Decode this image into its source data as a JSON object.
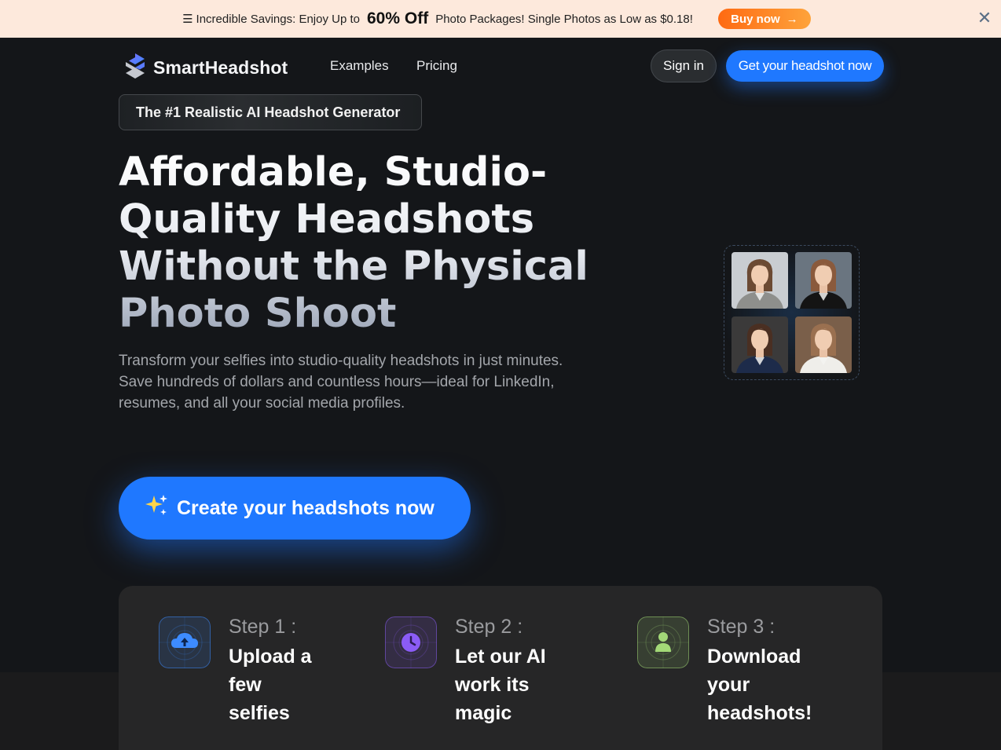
{
  "promo": {
    "menu_glyph": "☰",
    "text_before": "Incredible Savings: Enjoy Up to",
    "highlight": "60% Off",
    "text_after": "Photo Packages! Single Photos as Low as $0.18!",
    "button_label": "Buy now",
    "button_arrow": "→",
    "close_glyph": "✕",
    "colors": {
      "background": "#fde9dc",
      "button_start": "#fe6a12",
      "button_end": "#fea33b"
    }
  },
  "nav": {
    "logo_text": "SmartHeadshot",
    "links": [
      "Examples",
      "Pricing"
    ],
    "signin_label": "Sign in",
    "cta_label": "Get your headshot now",
    "accent": "#1f78ff"
  },
  "hero": {
    "badge": "The #1 Realistic AI Headshot Generator",
    "headline_lines": [
      "Affordable, Studio-",
      "Quality Headshots",
      "Without the Physical",
      "Photo Shoot"
    ],
    "sub_lines": [
      "Transform your selfies into studio-quality headshots in just minutes.",
      "Save hundreds of dollars and countless hours—ideal for LinkedIn,",
      "resumes, and all your social media profiles."
    ],
    "cta_label": "Create your headshots now",
    "cta_icon": "sparkles-icon"
  },
  "photos": [
    {
      "name": "headshot-photo-1",
      "bg": "#c9cdd1",
      "jacket": "#8e8f8c",
      "hair": "#6b4a33"
    },
    {
      "name": "headshot-photo-2",
      "bg": "#6a7580",
      "jacket": "#141414",
      "hair": "#8a5a3c"
    },
    {
      "name": "headshot-photo-3",
      "bg": "#3b3a3a",
      "jacket": "#1d2b4a",
      "hair": "#4a2f22"
    },
    {
      "name": "headshot-photo-4",
      "bg": "#7a5f4a",
      "jacket": "#efeeea",
      "hair": "#9a7050"
    }
  ],
  "steps": [
    {
      "label": "Step 1 :",
      "title_lines": [
        "Upload a",
        "few",
        "selfies"
      ],
      "icon": "cloud-upload-icon",
      "color": "#3d8bff"
    },
    {
      "label": "Step 2 :",
      "title_lines": [
        "Let our AI",
        "work its",
        "magic"
      ],
      "icon": "clock-icon",
      "color": "#8b5cf6"
    },
    {
      "label": "Step 3 :",
      "title_lines": [
        "Download",
        "your",
        "headshots!"
      ],
      "icon": "user-icon",
      "color": "#a3d977"
    }
  ]
}
